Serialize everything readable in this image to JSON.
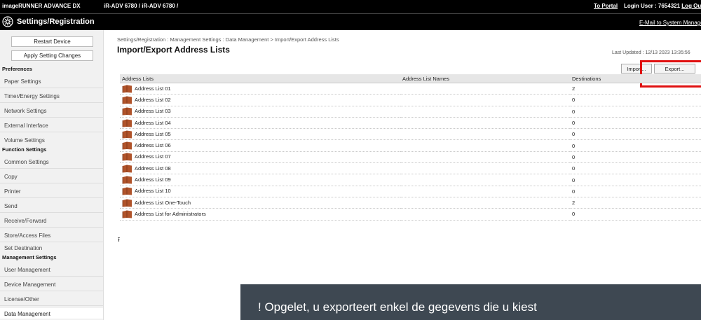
{
  "header": {
    "product": "imageRUNNER ADVANCE DX",
    "device": "iR-ADV 6780 / iR-ADV 6780 /",
    "portal_link": "To Portal",
    "login_label": "Login User :",
    "login_user": "7654321",
    "logout_link": "Log Out",
    "app_title": "Settings/Registration",
    "email_link": "E-Mail to System Manager"
  },
  "sidebar": {
    "restart_button": "Restart Device",
    "apply_button": "Apply Setting Changes",
    "sections": [
      {
        "heading": "Preferences",
        "items": [
          "Paper Settings",
          "Timer/Energy Settings",
          "Network Settings",
          "External Interface",
          "Volume Settings"
        ]
      },
      {
        "heading": "Function Settings",
        "items": [
          "Common Settings",
          "Copy",
          "Printer",
          "Send",
          "Receive/Forward",
          "Store/Access Files",
          "Set Destination"
        ]
      },
      {
        "heading": "Management Settings",
        "items": [
          "User Management",
          "Device Management",
          "License/Other",
          "Data Management"
        ]
      }
    ]
  },
  "main": {
    "breadcrumb": "Settings/Registration : Management Settings : Data Management > Import/Export Address Lists",
    "title": "Import/Export Address Lists",
    "last_updated": "Last Updated : 12/13 2023 13:35:56",
    "import_button": "Import...",
    "export_button": "Export...",
    "columns": [
      "Address Lists",
      "Address List Names",
      "Destinations"
    ],
    "rows": [
      {
        "list": "Address List 01",
        "name": "",
        "destinations": "2"
      },
      {
        "list": "Address List 02",
        "name": "",
        "destinations": "0"
      },
      {
        "list": "Address List 03",
        "name": "",
        "destinations": "0"
      },
      {
        "list": "Address List 04",
        "name": "",
        "destinations": "0"
      },
      {
        "list": "Address List 05",
        "name": "",
        "destinations": "0"
      },
      {
        "list": "Address List 06",
        "name": "",
        "destinations": "0"
      },
      {
        "list": "Address List 07",
        "name": "",
        "destinations": "0"
      },
      {
        "list": "Address List 08",
        "name": "",
        "destinations": "0"
      },
      {
        "list": "Address List 09",
        "name": "",
        "destinations": "0"
      },
      {
        "list": "Address List 10",
        "name": "",
        "destinations": "0"
      },
      {
        "list": "Address List One-Touch",
        "name": "",
        "destinations": "2"
      },
      {
        "list": "Address List for Administrators",
        "name": "",
        "destinations": "0"
      }
    ],
    "to_top_glyph": "⭱"
  },
  "toast": {
    "text": "! Opgelet, u exporteert enkel de gegevens die u kiest"
  },
  "colors": {
    "highlight": "#e01010",
    "book_icon": "#b0532a",
    "toast_bg": "#3e4852"
  },
  "icons": [
    "gear-icon",
    "address-book-icon",
    "to-top-icon"
  ]
}
